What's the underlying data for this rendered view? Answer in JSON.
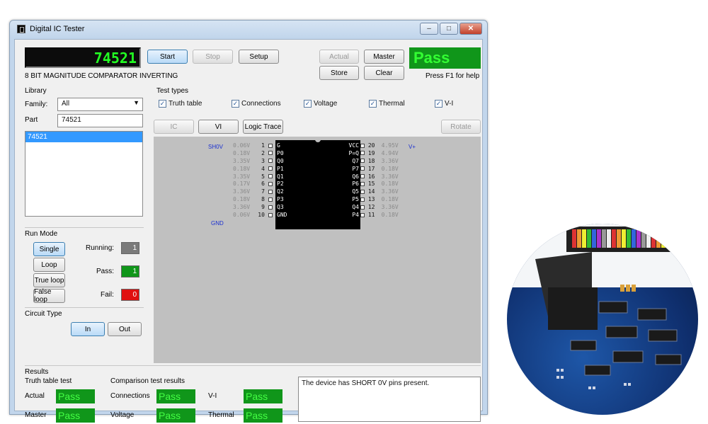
{
  "window": {
    "title": "Digital IC Tester",
    "min": "–",
    "max": "□",
    "close": "✕"
  },
  "top": {
    "ic_number": "74521",
    "description": "8 BIT MAGNITUDE COMPARATOR INVERTING",
    "start": "Start",
    "stop": "Stop",
    "setup": "Setup",
    "actual": "Actual",
    "master": "Master",
    "store": "Store",
    "clear": "Clear",
    "result": "Pass",
    "help": "Press F1 for help"
  },
  "library": {
    "title": "Library",
    "family_label": "Family:",
    "family_value": "All",
    "part_label": "Part",
    "part_value": "74521",
    "items": [
      "74521"
    ]
  },
  "test_types": {
    "title": "Test types",
    "items": [
      "Truth table",
      "Connections",
      "Voltage",
      "Thermal",
      "V-I"
    ]
  },
  "view_tabs": {
    "ic": "IC",
    "vi": "VI",
    "logic_trace": "Logic Trace",
    "rotate": "Rotate"
  },
  "chip": {
    "sh0v": "SH0V",
    "gnd_label": "GND",
    "vplus": "V+",
    "left_pins": [
      {
        "v": "0.06V",
        "n": "1",
        "name": "G"
      },
      {
        "v": "0.18V",
        "n": "2",
        "name": "P0"
      },
      {
        "v": "3.35V",
        "n": "3",
        "name": "Q0"
      },
      {
        "v": "0.18V",
        "n": "4",
        "name": "P1"
      },
      {
        "v": "3.35V",
        "n": "5",
        "name": "Q1"
      },
      {
        "v": "0.17V",
        "n": "6",
        "name": "P2"
      },
      {
        "v": "3.36V",
        "n": "7",
        "name": "Q2"
      },
      {
        "v": "0.18V",
        "n": "8",
        "name": "P3"
      },
      {
        "v": "3.36V",
        "n": "9",
        "name": "Q3"
      },
      {
        "v": "0.06V",
        "n": "10",
        "name": "GND"
      }
    ],
    "right_pins": [
      {
        "name": "VCC",
        "n": "20",
        "v": "4.95V"
      },
      {
        "name": "P=Q",
        "n": "19",
        "v": "4.94V"
      },
      {
        "name": "Q7",
        "n": "18",
        "v": "3.36V"
      },
      {
        "name": "P7",
        "n": "17",
        "v": "0.18V"
      },
      {
        "name": "Q6",
        "n": "16",
        "v": "3.36V"
      },
      {
        "name": "P6",
        "n": "15",
        "v": "0.18V"
      },
      {
        "name": "Q5",
        "n": "14",
        "v": "3.36V"
      },
      {
        "name": "P5",
        "n": "13",
        "v": "0.18V"
      },
      {
        "name": "Q4",
        "n": "12",
        "v": "3.36V"
      },
      {
        "name": "P4",
        "n": "11",
        "v": "0.18V"
      }
    ]
  },
  "run_mode": {
    "title": "Run Mode",
    "single": "Single",
    "loop": "Loop",
    "true_loop": "True loop",
    "false_loop": "False loop",
    "running_label": "Running:",
    "running_value": "1",
    "pass_label": "Pass:",
    "pass_value": "1",
    "fail_label": "Fail:",
    "fail_value": "0"
  },
  "circuit_type": {
    "title": "Circuit Type",
    "in": "In",
    "out": "Out"
  },
  "results": {
    "title": "Results",
    "truth_title": "Truth table test",
    "comparison_title": "Comparison test results",
    "actual_label": "Actual",
    "actual_value": "Pass",
    "master_label": "Master",
    "master_value": "Pass",
    "connections_label": "Connections",
    "connections_value": "Pass",
    "voltage_label": "Voltage",
    "voltage_value": "Pass",
    "vi_label": "V-I",
    "vi_value": "Pass",
    "thermal_label": "Thermal",
    "thermal_value": "Pass",
    "message": "The device has SHORT 0V pins present."
  },
  "colors": {
    "pass_green": "#10961a",
    "fail_red": "#e01010",
    "select_blue": "#3399ff",
    "accent": "#3c7fb1"
  }
}
